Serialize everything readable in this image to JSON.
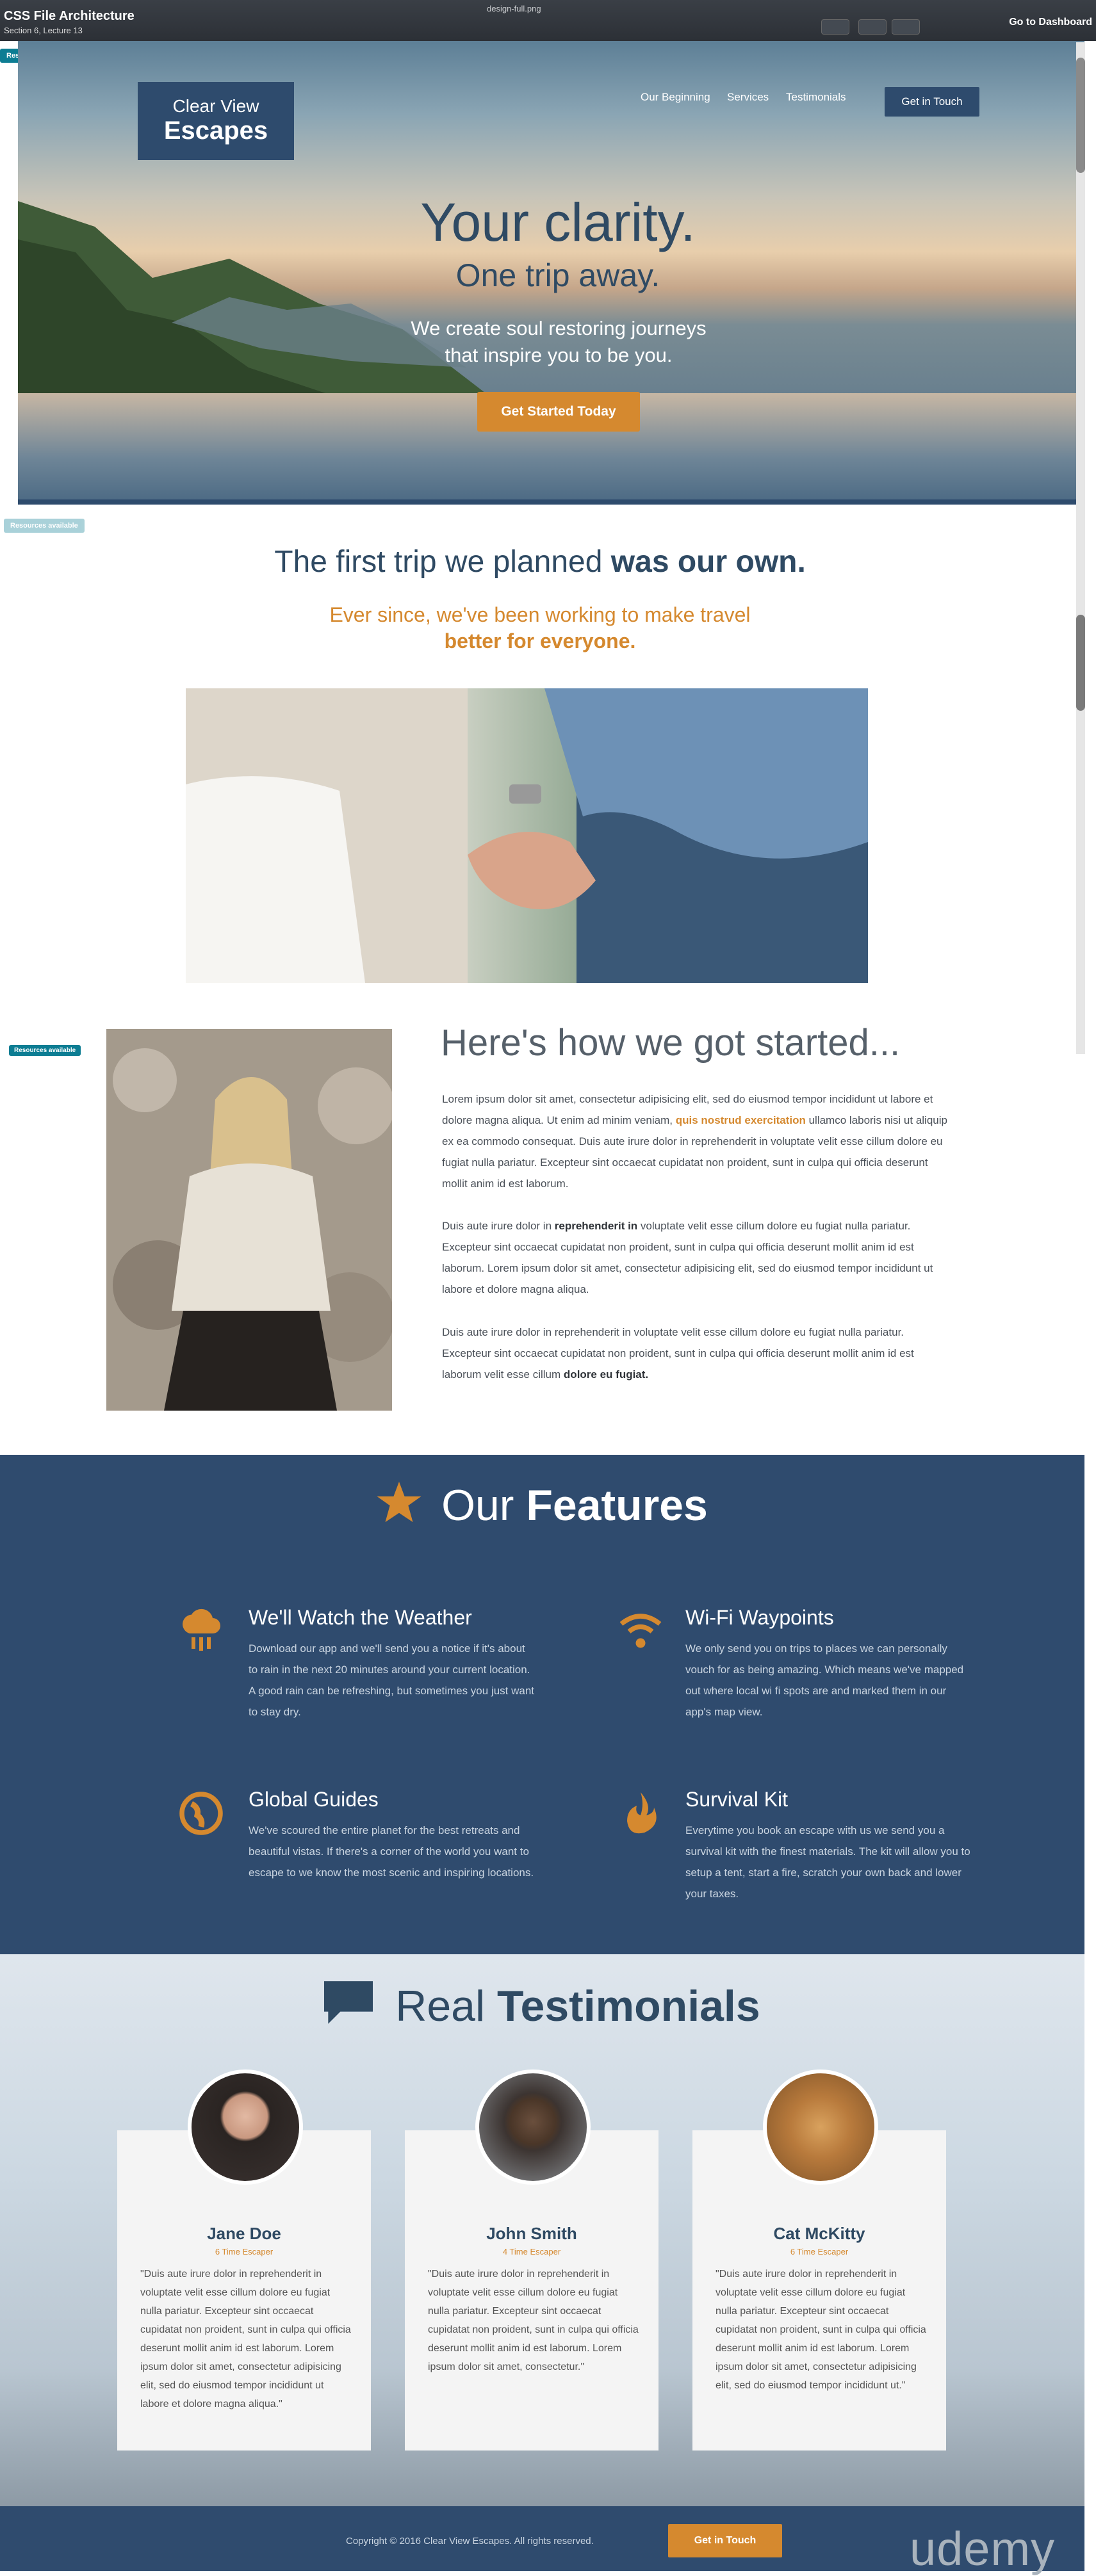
{
  "overlay": {
    "course_title": "CSS File Architecture",
    "lecture": "Section 6, Lecture 13",
    "filename": "design-full.png",
    "dashboard_link": "Go to Dashboard",
    "resources_badge": "Resources available"
  },
  "header": {
    "logo_line1": "Clear View",
    "logo_line2": "Escapes",
    "nav": [
      "Our Beginning",
      "Services",
      "Testimonials"
    ],
    "cta": "Get in Touch"
  },
  "hero": {
    "title": "Your clarity.",
    "subtitle": "One trip away.",
    "text": "We create soul restoring journeys that inspire you to be you.",
    "button": "Get Started Today"
  },
  "story": {
    "heading_a": "The first trip we planned",
    "heading_b": "was our own.",
    "sub_a": "Ever since, we've been working to make travel",
    "sub_b": "better for everyone."
  },
  "how": {
    "heading": "Here's how we got started...",
    "p1_a": "Lorem ipsum dolor sit amet, consectetur adipisicing elit, sed do eiusmod tempor incididunt ut labore et dolore magna aliqua. Ut enim ad minim veniam,",
    "p1_hl": "quis nostrud exercitation",
    "p1_b": "ullamco laboris nisi ut aliquip ex ea commodo consequat. Duis aute irure dolor in reprehenderit in voluptate velit esse cillum dolore eu fugiat nulla pariatur. Excepteur sint occaecat cupidatat non proident, sunt in culpa qui officia deserunt mollit anim id est laborum.",
    "p2_a": "Duis aute irure dolor in",
    "p2_b": "reprehenderit in",
    "p2_c": "voluptate velit esse cillum dolore eu fugiat nulla pariatur. Excepteur sint occaecat cupidatat non proident, sunt in culpa qui officia deserunt mollit anim id est laborum. Lorem ipsum dolor sit amet, consectetur adipisicing elit, sed do eiusmod tempor incididunt ut labore et dolore magna aliqua.",
    "p3_a": "Duis aute irure dolor in reprehenderit in voluptate velit esse cillum dolore eu fugiat nulla pariatur. Excepteur sint occaecat cupidatat non proident, sunt in culpa qui officia deserunt mollit anim id est laborum velit esse cillum",
    "p3_b": "dolore eu fugiat."
  },
  "features": {
    "title_a": "Our",
    "title_b": "Features",
    "items": [
      {
        "title": "We'll Watch the Weather",
        "text": "Download our app and we'll send you a notice if it's about to rain in the next 20 minutes around your current location. A good rain can be refreshing, but sometimes you just want to stay dry."
      },
      {
        "title": "Wi-Fi Waypoints",
        "text": "We only send you on trips to places we can personally vouch for as being amazing. Which means we've mapped out where local wi fi spots are and marked them in our app's map view."
      },
      {
        "title": "Global Guides",
        "text": "We've scoured the entire planet for the best retreats and beautiful vistas. If there's a corner of the world you want to escape to we know the most scenic and inspiring locations."
      },
      {
        "title": "Survival Kit",
        "text": "Everytime you book an escape with us we send you a survival kit with the finest materials. The kit will allow you to setup a tent, start a fire, scratch your own back and lower your taxes."
      }
    ]
  },
  "testimonials": {
    "title_a": "Real",
    "title_b": "Testimonials",
    "items": [
      {
        "name": "Jane Doe",
        "meta": "6 Time Escaper",
        "quote": "\"Duis aute irure dolor in reprehenderit in voluptate velit esse cillum dolore eu fugiat nulla pariatur. Excepteur sint occaecat cupidatat non proident, sunt in culpa qui officia deserunt mollit anim id est laborum. Lorem ipsum dolor sit amet, consectetur adipisicing elit, sed do eiusmod tempor incididunt ut labore et dolore magna aliqua.\""
      },
      {
        "name": "John Smith",
        "meta": "4 Time Escaper",
        "quote": "\"Duis aute irure dolor in reprehenderit in voluptate velit esse cillum dolore eu fugiat nulla pariatur. Excepteur sint occaecat cupidatat non proident, sunt in culpa qui officia deserunt mollit anim id est laborum. Lorem ipsum dolor sit amet, consectetur.\""
      },
      {
        "name": "Cat McKitty",
        "meta": "6 Time Escaper",
        "quote": "\"Duis aute irure dolor in reprehenderit in voluptate velit esse cillum dolore eu fugiat nulla pariatur. Excepteur sint occaecat cupidatat non proident, sunt in culpa qui officia deserunt mollit anim id est laborum. Lorem ipsum dolor sit amet, consectetur adipisicing elit, sed do eiusmod tempor incididunt ut.\""
      }
    ]
  },
  "footer": {
    "copyright": "Copyright © 2016 Clear View Escapes. All rights reserved.",
    "cta": "Get in Touch",
    "watermark": "udemy"
  },
  "colors": {
    "navy": "#2f4b6e",
    "orange": "#d5892f",
    "badge": "#0d7d93"
  }
}
